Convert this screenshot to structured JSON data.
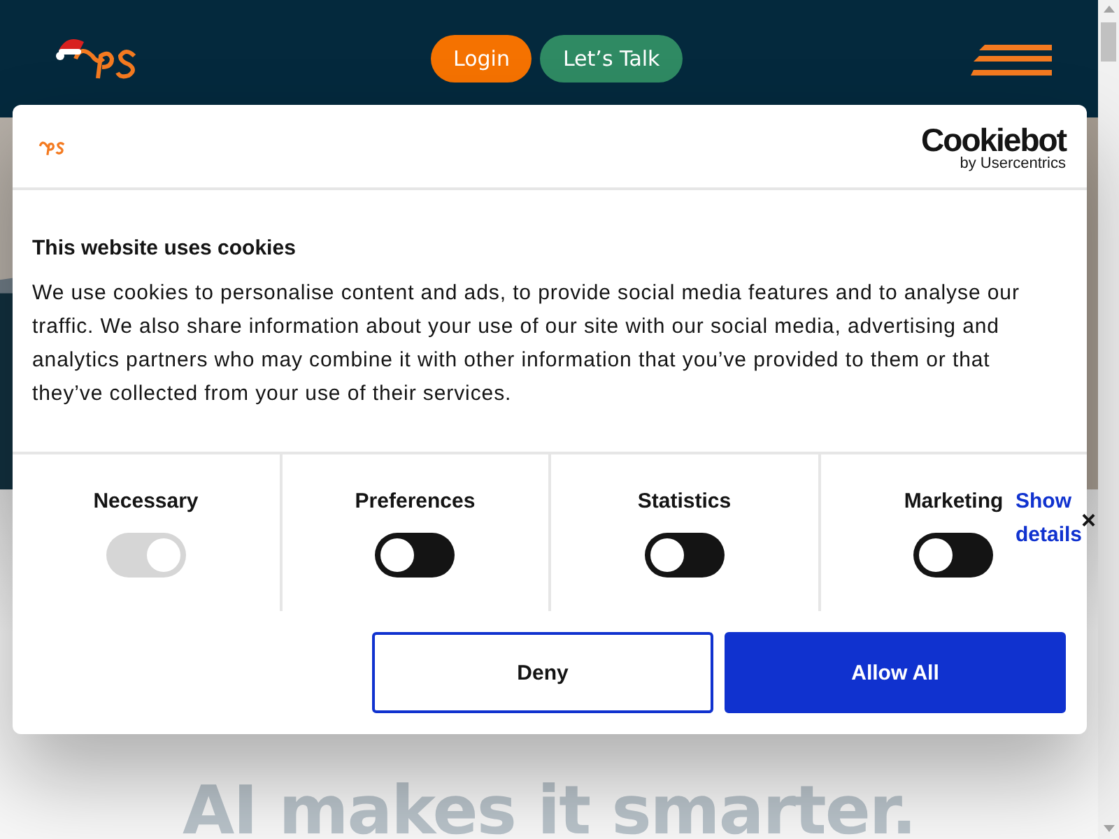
{
  "header": {
    "buttons": [
      {
        "label": "Login",
        "kind": "primary"
      },
      {
        "label": "Let’s Talk",
        "kind": "secondary"
      }
    ]
  },
  "hero": {
    "lines": [
      "AI makes it smarter."
    ]
  },
  "cookie_dialog": {
    "title": "This website uses cookies",
    "text": "We use cookies to personalise content and ads, to provide social media features and to analyse our traffic. We also share information about your use of our site with our social media, advertising and analytics partners who may combine it with other information that you’ve provided to them or that they’ve collected from your use of their services.",
    "brand": "Cookiebot",
    "brand_sub": "by Usercentrics",
    "categories": [
      {
        "label": "Necessary",
        "checked": true,
        "disabled": true
      },
      {
        "label": "Preferences",
        "checked": false,
        "disabled": false
      },
      {
        "label": "Statistics",
        "checked": false,
        "disabled": false
      },
      {
        "label": "Marketing",
        "checked": false,
        "disabled": false
      }
    ],
    "show_details": "Show details",
    "close": "×",
    "buttons": [
      {
        "label": "Deny",
        "kind": "outline"
      },
      {
        "label": "Allow All",
        "kind": "filled"
      }
    ]
  }
}
